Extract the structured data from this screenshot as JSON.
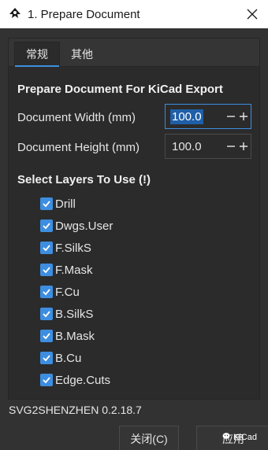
{
  "window": {
    "title": "1. Prepare Document",
    "icon": "inkscape-icon",
    "close_icon": "close-icon"
  },
  "tabs": [
    {
      "label": "常规",
      "active": true
    },
    {
      "label": "其他",
      "active": false
    }
  ],
  "section_export": {
    "title": "Prepare Document For KiCad Export"
  },
  "fields": {
    "width": {
      "label": "Document Width (mm)",
      "value": "100.0",
      "focused": true
    },
    "height": {
      "label": "Document Height (mm)",
      "value": "100.0",
      "focused": false
    }
  },
  "layers": {
    "title": "Select Layers To Use (!)",
    "items": [
      {
        "label": "Drill",
        "checked": true
      },
      {
        "label": "Dwgs.User",
        "checked": true
      },
      {
        "label": "F.SilkS",
        "checked": true
      },
      {
        "label": "F.Mask",
        "checked": true
      },
      {
        "label": "F.Cu",
        "checked": true
      },
      {
        "label": "B.SilkS",
        "checked": true
      },
      {
        "label": "B.Mask",
        "checked": true
      },
      {
        "label": "B.Cu",
        "checked": true
      },
      {
        "label": "Edge.Cuts",
        "checked": true
      }
    ]
  },
  "footer": {
    "version": "SVG2SHENZHEN 0.2.18.7",
    "close_label": "关闭(C)",
    "apply_label": "应用"
  },
  "watermark": {
    "text": "KiCad"
  },
  "colors": {
    "accent": "#3d8ee0",
    "background": "#323232",
    "panel": "#2b2b2b",
    "titlebar": "#ffffff"
  }
}
